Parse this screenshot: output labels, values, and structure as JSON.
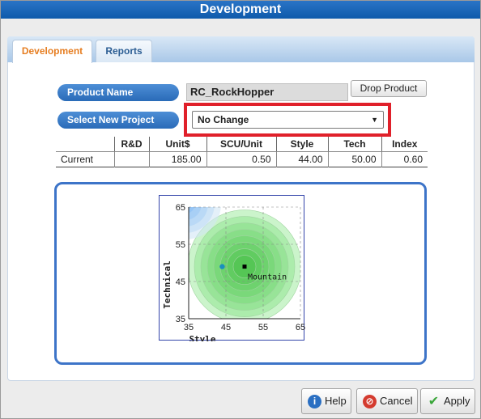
{
  "window": {
    "title": "Development"
  },
  "tabs": [
    {
      "label": "Development",
      "active": true
    },
    {
      "label": "Reports",
      "active": false
    }
  ],
  "form": {
    "product_name_label": "Product Name",
    "product_name_value": "RC_RockHopper",
    "drop_product_label": "Drop Product",
    "select_project_label": "Select New Project",
    "select_project_value": "No Change"
  },
  "table": {
    "headers": [
      "",
      "R&D",
      "Unit$",
      "SCU/Unit",
      "Style",
      "Tech",
      "Index"
    ],
    "rows": [
      [
        "Current",
        "",
        "185.00",
        "0.50",
        "44.00",
        "50.00",
        "0.60"
      ]
    ]
  },
  "chart_data": {
    "type": "scatter",
    "xlabel": "Style",
    "ylabel": "Technical",
    "xlim": [
      35,
      65
    ],
    "ylim": [
      35,
      65
    ],
    "xticks": [
      "35",
      "45",
      "55",
      "65"
    ],
    "yticks": [
      "65",
      "55",
      "45",
      "35"
    ],
    "segments": [
      {
        "name": "Mountain",
        "center": [
          50,
          49
        ]
      }
    ],
    "points": [
      {
        "label": "Mountain",
        "x": 50,
        "y": 49,
        "color": "#000000",
        "marker": "square"
      },
      {
        "label": "",
        "x": 44,
        "y": 49,
        "color": "#1a8fbf",
        "marker": "circle"
      }
    ],
    "grid": true
  },
  "buttons": {
    "help": "Help",
    "cancel": "Cancel",
    "apply": "Apply"
  },
  "colors": {
    "title_bar": "#1766b9",
    "accent_tab": "#e67e22",
    "pill": "#2f73c2",
    "highlight": "#e0202a"
  }
}
